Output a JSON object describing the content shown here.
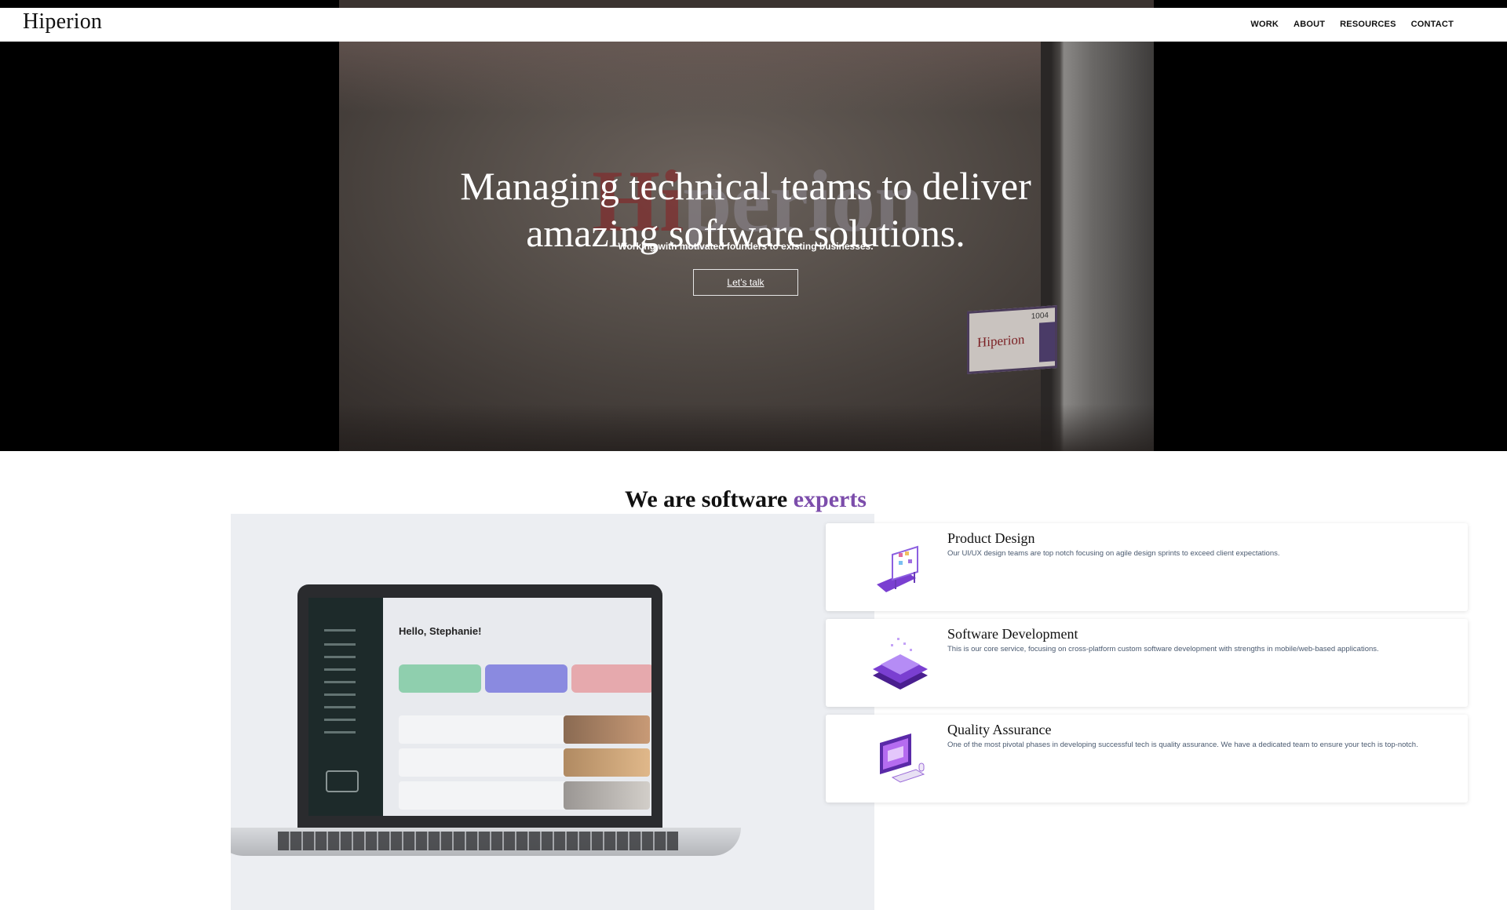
{
  "brand": {
    "logo": "Hiperion"
  },
  "nav": {
    "items": [
      "WORK",
      "ABOUT",
      "RESOURCES",
      "CONTACT"
    ]
  },
  "hero": {
    "title_line1": "Managing technical teams to deliver",
    "title_line2": "amazing software solutions.",
    "subtitle": "Working with motivated founders to existing businesses.",
    "cta": "Let’s talk",
    "wall_logo_hi": "Hi",
    "wall_logo_rest": "perion",
    "plaque_text": "Hiperion",
    "plaque_number": "1004"
  },
  "experts": {
    "heading_plain": "We are software",
    "heading_accent": "experts"
  },
  "laptop_screen": {
    "greeting": "Hello, Stephanie!"
  },
  "services": [
    {
      "title": "Product Design",
      "description": "Our UI/UX design teams are top notch focusing on agile design sprints to exceed client expectations.",
      "icon": "design-board-icon"
    },
    {
      "title": "Software Development",
      "description": "This is our core service, focusing on cross-platform custom software development with strengths in mobile/web-based applications.",
      "icon": "layered-platform-icon"
    },
    {
      "title": "Quality Assurance",
      "description": "One of the most pivotal phases in developing successful tech is quality assurance. We have a dedicated team to ensure your tech is top-notch.",
      "icon": "monitor-check-icon"
    }
  ],
  "colors": {
    "accent": "#7c4dab",
    "hero_bg": "#000000",
    "card_text": "#4a5a70"
  }
}
